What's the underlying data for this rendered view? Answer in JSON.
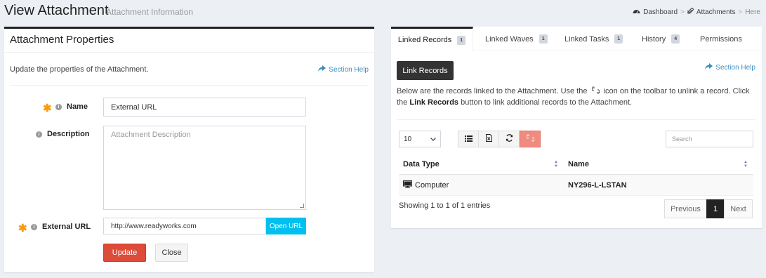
{
  "header": {
    "title": "View Attachment",
    "subtitle": "Attachment Information",
    "breadcrumb": {
      "dashboard": "Dashboard",
      "attachments": "Attachments",
      "here": "Here",
      "separator": ">"
    }
  },
  "properties": {
    "title": "Attachment Properties",
    "description": "Update the properties of the Attachment.",
    "section_help": "Section Help",
    "name_label": "Name",
    "name_value": "External URL",
    "description_label": "Description",
    "description_placeholder": "Attachment Description",
    "url_label": "External URL",
    "url_value": "http://www.readyworks.com",
    "open_url": "Open URL",
    "update": "Update",
    "close": "Close",
    "required_mark": "✱",
    "info_mark": "i"
  },
  "tabs": [
    {
      "label": "Linked Records",
      "count": "1"
    },
    {
      "label": "Linked Waves",
      "count": "1"
    },
    {
      "label": "Linked Tasks",
      "count": "1"
    },
    {
      "label": "History",
      "count": "4"
    },
    {
      "label": "Permissions"
    }
  ],
  "linked": {
    "link_button": "Link Records",
    "section_help": "Section Help",
    "help_part1": "Below are the records linked to the Attachment. Use the",
    "help_part2": "icon on the toolbar to unlink a record. Click the",
    "help_bold": "Link Records",
    "help_part3": "button to link additional records to the Attachment.",
    "page_size": "10",
    "search_placeholder": "Search",
    "columns": [
      "Data Type",
      "Name"
    ],
    "rows": [
      {
        "data_type": "Computer",
        "name": "NY296-L-LSTAN"
      }
    ],
    "entries": "Showing 1 to 1 of 1 entries",
    "pager": {
      "previous": "Previous",
      "page": "1",
      "next": "Next"
    }
  },
  "icons": {
    "breadcrumb_dashboard": "dashboard-icon",
    "breadcrumb_attachments": "paperclip-icon",
    "section_help": "share-arrow-icon",
    "toolbar": [
      "list-icon",
      "excel-icon",
      "refresh-icon",
      "unlink-icon"
    ],
    "row_type": "computer-icon"
  },
  "colors": {
    "required": "#f39c12",
    "link": "#3c8dbc",
    "update": "#dd4b39",
    "open_url": "#00c0ef",
    "unlink": "#f08b7f"
  }
}
